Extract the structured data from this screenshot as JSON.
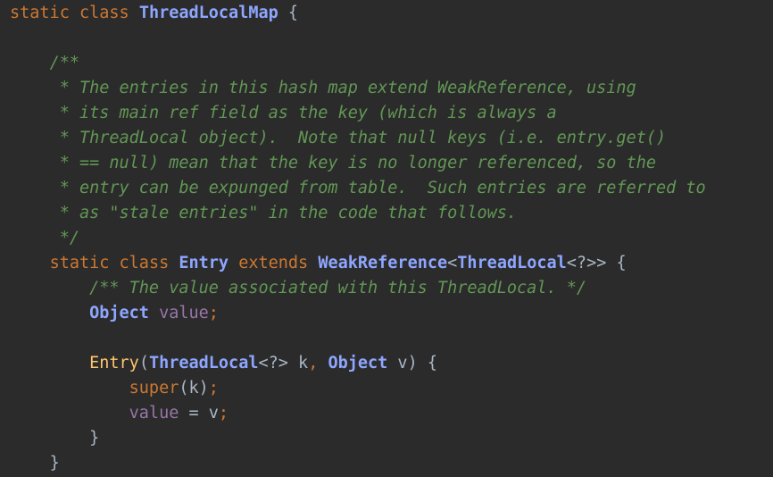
{
  "editor": {
    "lines": [
      {
        "indent": "",
        "tokens": [
          {
            "t": "static",
            "c": "kw"
          },
          {
            "t": " ",
            "c": "txt"
          },
          {
            "t": "class",
            "c": "kw"
          },
          {
            "t": " ",
            "c": "txt"
          },
          {
            "t": "ThreadLocalMap",
            "c": "cls-b"
          },
          {
            "t": " {",
            "c": "txt"
          }
        ]
      },
      {
        "indent": "",
        "tokens": []
      },
      {
        "indent": "    ",
        "tokens": [
          {
            "t": "/**",
            "c": "doc"
          }
        ]
      },
      {
        "indent": "     ",
        "tokens": [
          {
            "t": "* The entries in this hash map extend WeakReference, using",
            "c": "doc"
          }
        ]
      },
      {
        "indent": "     ",
        "tokens": [
          {
            "t": "* its main ref field as the key (which is always a",
            "c": "doc"
          }
        ]
      },
      {
        "indent": "     ",
        "tokens": [
          {
            "t": "* ThreadLocal object).  Note that null keys (i.e. entry.get()",
            "c": "doc"
          }
        ]
      },
      {
        "indent": "     ",
        "tokens": [
          {
            "t": "* == null) mean that the key is no longer referenced, so the",
            "c": "doc"
          }
        ]
      },
      {
        "indent": "     ",
        "tokens": [
          {
            "t": "* entry can be expunged from table.  Such entries are referred to",
            "c": "doc"
          }
        ]
      },
      {
        "indent": "     ",
        "tokens": [
          {
            "t": "* as \"stale entries\" in the code that follows.",
            "c": "doc"
          }
        ]
      },
      {
        "indent": "     ",
        "tokens": [
          {
            "t": "*/",
            "c": "doc"
          }
        ]
      },
      {
        "indent": "    ",
        "tokens": [
          {
            "t": "static",
            "c": "kw"
          },
          {
            "t": " ",
            "c": "txt"
          },
          {
            "t": "class",
            "c": "kw"
          },
          {
            "t": " ",
            "c": "txt"
          },
          {
            "t": "Entry",
            "c": "cls-b"
          },
          {
            "t": " ",
            "c": "txt"
          },
          {
            "t": "extends",
            "c": "kw"
          },
          {
            "t": " ",
            "c": "txt"
          },
          {
            "t": "WeakReference",
            "c": "cls-b"
          },
          {
            "t": "<",
            "c": "txt"
          },
          {
            "t": "ThreadLocal",
            "c": "cls-b"
          },
          {
            "t": "<?>> {",
            "c": "txt"
          }
        ]
      },
      {
        "indent": "        ",
        "tokens": [
          {
            "t": "/** The value associated with this ThreadLocal. */",
            "c": "doc"
          }
        ]
      },
      {
        "indent": "        ",
        "tokens": [
          {
            "t": "Object",
            "c": "cls-b"
          },
          {
            "t": " ",
            "c": "txt"
          },
          {
            "t": "value",
            "c": "fld"
          },
          {
            "t": ";",
            "c": "kw"
          }
        ]
      },
      {
        "indent": "",
        "tokens": []
      },
      {
        "indent": "        ",
        "tokens": [
          {
            "t": "Entry",
            "c": "fn"
          },
          {
            "t": "(",
            "c": "txt"
          },
          {
            "t": "ThreadLocal",
            "c": "cls-b"
          },
          {
            "t": "<?> k",
            "c": "txt"
          },
          {
            "t": ",",
            "c": "kw"
          },
          {
            "t": " ",
            "c": "txt"
          },
          {
            "t": "Object",
            "c": "cls-b"
          },
          {
            "t": " v) {",
            "c": "txt"
          }
        ]
      },
      {
        "indent": "            ",
        "tokens": [
          {
            "t": "super",
            "c": "kw"
          },
          {
            "t": "(k)",
            "c": "txt"
          },
          {
            "t": ";",
            "c": "kw"
          }
        ]
      },
      {
        "indent": "            ",
        "tokens": [
          {
            "t": "value",
            "c": "fld"
          },
          {
            "t": " = v",
            "c": "txt"
          },
          {
            "t": ";",
            "c": "kw"
          }
        ]
      },
      {
        "indent": "        ",
        "tokens": [
          {
            "t": "}",
            "c": "txt"
          }
        ]
      },
      {
        "indent": "    ",
        "tokens": [
          {
            "t": "}",
            "c": "txt"
          }
        ]
      }
    ]
  }
}
